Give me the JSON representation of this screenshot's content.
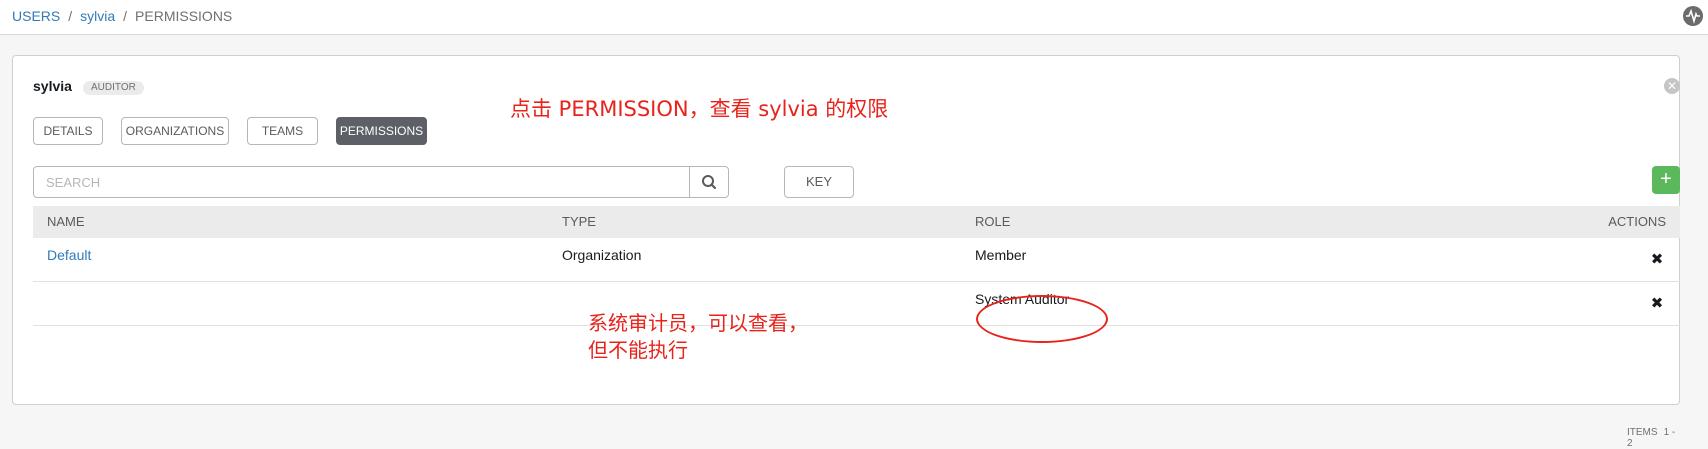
{
  "breadcrumb": {
    "users": "USERS",
    "user": "sylvia",
    "current": "PERMISSIONS",
    "separator": "/"
  },
  "user": {
    "name": "sylvia",
    "badge": "AUDITOR"
  },
  "tabs": [
    {
      "label": "DETAILS",
      "active": false
    },
    {
      "label": "ORGANIZATIONS",
      "active": false
    },
    {
      "label": "TEAMS",
      "active": false
    },
    {
      "label": "PERMISSIONS",
      "active": true
    }
  ],
  "search": {
    "placeholder": "SEARCH",
    "value": ""
  },
  "key_button": "KEY",
  "add_button": "+",
  "table": {
    "columns": [
      "NAME",
      "TYPE",
      "ROLE",
      "ACTIONS"
    ],
    "rows": [
      {
        "name": "Default",
        "type": "Organization",
        "role": "Member"
      },
      {
        "name": "",
        "type": "",
        "role": "System Auditor"
      }
    ]
  },
  "footer": {
    "label": "ITEMS",
    "range": "1 - 2"
  },
  "annotations": {
    "top": "点击 PERMISSION，查看 sylvia 的权限",
    "note_line1": "系统审计员，可以查看，",
    "note_line2": "但不能执行"
  },
  "colors": {
    "link": "#337ab7",
    "annotation": "#e8231c",
    "add": "#5cb85c",
    "active_tab": "#5d6167"
  }
}
